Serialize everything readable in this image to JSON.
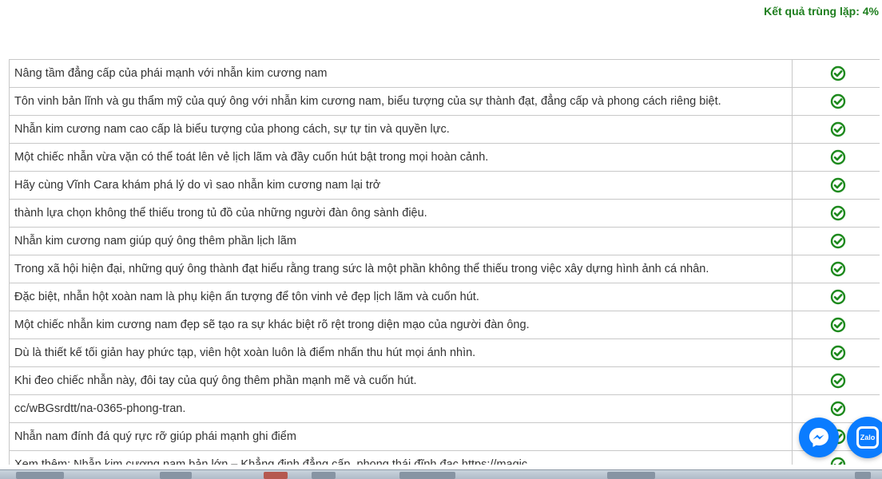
{
  "header": {
    "result_text": "Kết quả trùng lặp: 4%",
    "accent_color": "#1e7e1e"
  },
  "results": {
    "status_icon": "check-circle-icon",
    "status_color": "#1e8a1e",
    "rows": [
      {
        "text": "Nâng tầm đẳng cấp của phái mạnh với nhẫn kim cương nam"
      },
      {
        "text": "Tôn vinh bản lĩnh và gu thẩm mỹ của quý ông với nhẫn kim cương nam, biểu tượng của sự thành đạt, đẳng cấp và phong cách riêng biệt."
      },
      {
        "text": "Nhẫn kim cương nam cao cấp là biểu tượng của phong cách, sự tự tin và quyền lực."
      },
      {
        "text": "Một chiếc nhẫn vừa vặn có thể toát lên vẻ lịch lãm và đầy cuốn hút bật trong mọi hoàn cảnh."
      },
      {
        "text": "Hãy cùng Vĩnh Cara khám phá lý do vì sao nhẫn kim cương nam lại trở"
      },
      {
        "text": "thành lựa chọn không thể thiếu trong tủ đồ của những người đàn ông sành điệu."
      },
      {
        "text": "Nhẫn kim cương nam giúp quý ông thêm phần lịch lãm"
      },
      {
        "text": "Trong xã hội hiện đại, những quý ông thành đạt hiểu rằng trang sức là một phần không thể thiếu trong việc xây dựng hình ảnh cá nhân."
      },
      {
        "text": "Đặc biệt, nhẫn hột xoàn nam là phụ kiện ấn tượng để tôn vinh vẻ đẹp lịch lãm và cuốn hút."
      },
      {
        "text": "Một chiếc nhẫn kim cương nam đẹp sẽ tạo ra sự khác biệt rõ rệt trong diện mạo của người đàn ông."
      },
      {
        "text": "Dù là thiết kế tối giản hay phức tạp, viên hột xoàn luôn là điểm nhấn thu hút mọi ánh nhìn."
      },
      {
        "text": "Khi đeo chiếc nhẫn này, đôi tay của quý ông thêm phần mạnh mẽ và cuốn hút."
      },
      {
        "text": "cc/wBGsrdtt/na-0365-phong-tran."
      },
      {
        "text": "Nhẫn nam đính đá quý rực rỡ giúp phái mạnh ghi điểm"
      },
      {
        "text": "Xem thêm: Nhẫn kim cương nam bản lớn – Khẳng định đẳng cấp, phong thái đĩnh đạc https://magic"
      }
    ]
  },
  "floating_buttons": {
    "messenger_icon": "messenger-icon",
    "zalo_icon": "zalo-icon",
    "zalo_label": "Zalo",
    "button_color": "#0a7cff"
  }
}
